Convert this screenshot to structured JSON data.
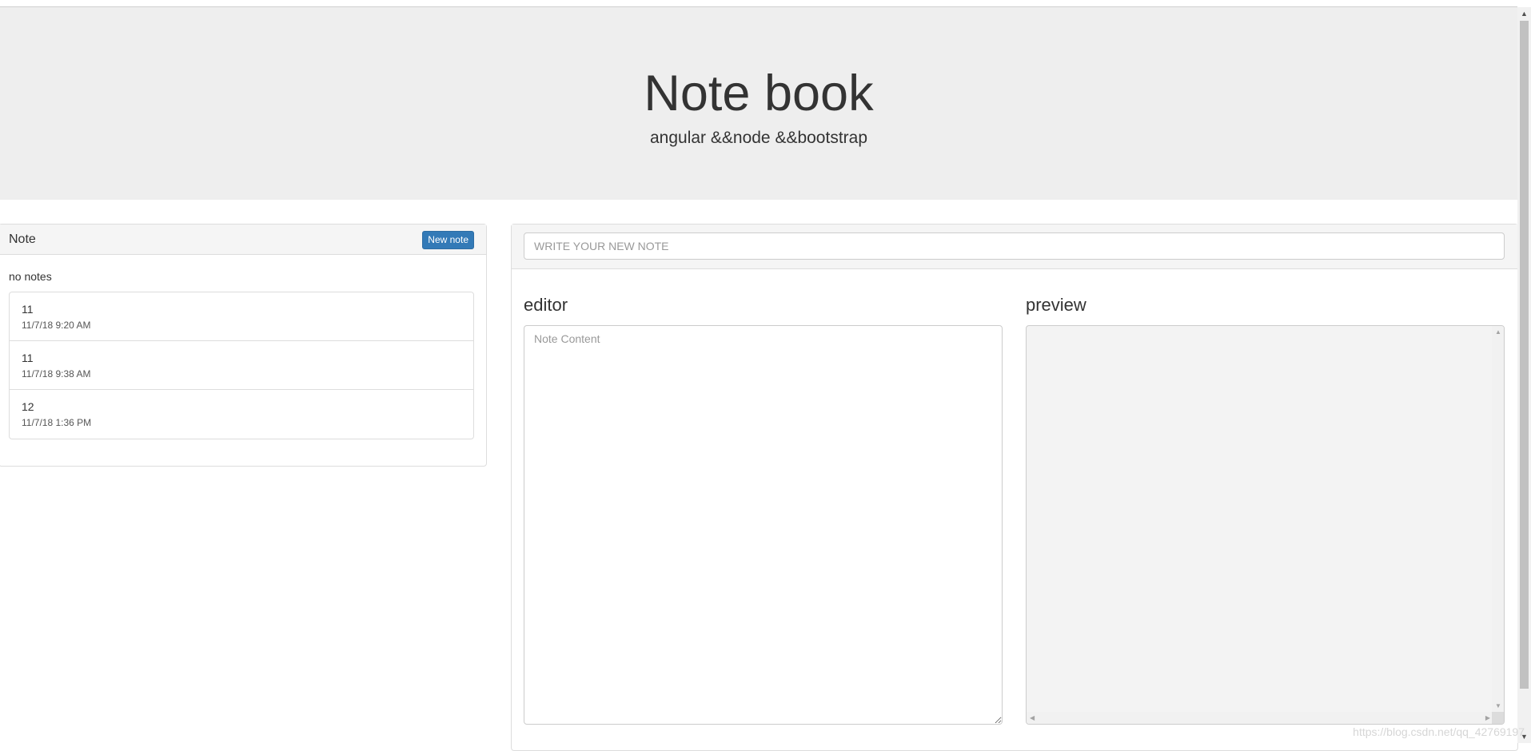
{
  "header": {
    "title": "Note book",
    "subtitle": "angular &&node &&bootstrap"
  },
  "notes_panel": {
    "title": "Note",
    "new_note_label": "New note",
    "empty_text": "no notes",
    "items": [
      {
        "title": "11",
        "time": "11/7/18 9:20 AM"
      },
      {
        "title": "11",
        "time": "11/7/18 9:38 AM"
      },
      {
        "title": "12",
        "time": "11/7/18 1:36 PM"
      }
    ]
  },
  "edit_panel": {
    "title_placeholder": "WRITE YOUR NEW NOTE",
    "editor_heading": "editor",
    "editor_placeholder": "Note Content",
    "preview_heading": "preview"
  },
  "icons": {
    "scroll_up": "triangle-up-icon",
    "scroll_down": "triangle-down-icon",
    "scroll_left": "triangle-left-icon",
    "scroll_right": "triangle-right-icon",
    "resize_grip": "resize-grip-icon"
  },
  "colors": {
    "jumbotron_bg": "#eeeeee",
    "primary_button": "#337ab7",
    "panel_heading_bg": "#f5f5f5",
    "border": "#dddddd"
  },
  "watermark": "https://blog.csdn.net/qq_42769197"
}
